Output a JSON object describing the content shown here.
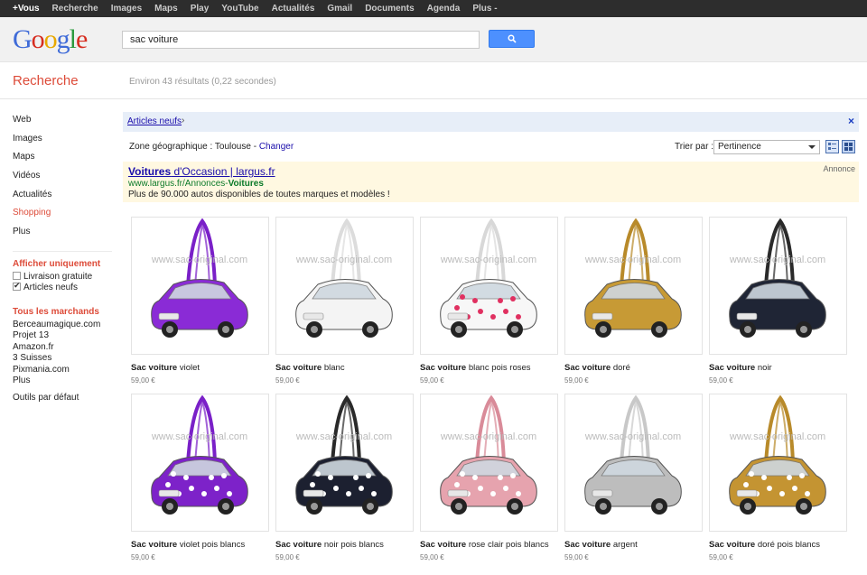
{
  "topnav": [
    "+Vous",
    "Recherche",
    "Images",
    "Maps",
    "Play",
    "YouTube",
    "Actualités",
    "Gmail",
    "Documents",
    "Agenda",
    "Plus -"
  ],
  "header": {
    "logo": "Google",
    "query": "sac voiture"
  },
  "results": {
    "section_title": "Recherche",
    "stats": "Environ 43 résultats (0,22 secondes)"
  },
  "leftnav": {
    "items": [
      "Web",
      "Images",
      "Maps",
      "Vidéos",
      "Actualités",
      "Shopping",
      "Plus"
    ],
    "active_index": 5,
    "filter_title": "Afficher uniquement",
    "filters": [
      {
        "label": "Livraison gratuite",
        "checked": false
      },
      {
        "label": "Articles neufs",
        "checked": true
      }
    ],
    "merchants_title": "Tous les marchands",
    "merchants": [
      "Berceaumagique.com",
      "Projet 13",
      "Amazon.fr",
      "3 Suisses",
      "Pixmania.com",
      "Plus"
    ],
    "tools": "Outils par défaut"
  },
  "filterbar": {
    "chip": "Articles neufs",
    "arrow": "›",
    "close": "×"
  },
  "zone": {
    "label": "Zone géographique : Toulouse - ",
    "change": "Changer"
  },
  "sort": {
    "label": "Trier par :",
    "value": "Pertinence"
  },
  "ad": {
    "title_bold": "Voitures",
    "title_rest": " d'Occasion | largus.fr",
    "url_start": "www.largus.fr/Annonces-",
    "url_bold": "Voitures",
    "description": "Plus de 90.000 autos disponibles de toutes marques et modèles !",
    "label": "Annonce"
  },
  "watermark": "www.sac-original.com",
  "colors": {
    "accent_red": "#dd4b39",
    "link": "#1a0dab",
    "url_green": "#0b7a29",
    "button_blue": "#4d90fe"
  },
  "products": [
    {
      "bold": "Sac voiture",
      "rest": " violet",
      "price": "59,00 €",
      "color": "#8a2bd6",
      "dots": "none",
      "strap": "#7a20c8"
    },
    {
      "bold": "Sac voiture",
      "rest": " blanc",
      "price": "59,00 €",
      "color": "#f4f4f4",
      "dots": "none",
      "strap": "#dcdcdc"
    },
    {
      "bold": "Sac voiture",
      "rest": " blanc pois roses",
      "price": "59,00 €",
      "color": "#f7f7f7",
      "dots": "#e03060",
      "strap": "#d8d8d8"
    },
    {
      "bold": "Sac voiture",
      "rest": " doré",
      "price": "59,00 €",
      "color": "#c79a35",
      "dots": "none",
      "strap": "#b88a2a"
    },
    {
      "bold": "Sac voiture",
      "rest": " noir",
      "price": "59,00 €",
      "color": "#1f2535",
      "dots": "none",
      "strap": "#2a2a2a"
    },
    {
      "bold": "Sac voiture",
      "rest": " violet pois blancs",
      "price": "59,00 €",
      "color": "#7d22c9",
      "dots": "#ffffff",
      "strap": "#7a20c8"
    },
    {
      "bold": "Sac voiture",
      "rest": " noir pois blancs",
      "price": "59,00 €",
      "color": "#1c2030",
      "dots": "#ffffff",
      "strap": "#2a2a2a"
    },
    {
      "bold": "Sac voiture",
      "rest": " rose clair pois blancs",
      "price": "59,00 €",
      "color": "#e6a3ae",
      "dots": "#ffffff",
      "strap": "#d98b99"
    },
    {
      "bold": "Sac voiture",
      "rest": " argent",
      "price": "59,00 €",
      "color": "#bdbdbd",
      "dots": "none",
      "strap": "#c8c8c8"
    },
    {
      "bold": "Sac voiture",
      "rest": " doré pois blancs",
      "price": "59,00 €",
      "color": "#c49432",
      "dots": "#ffffff",
      "strap": "#b88a2a"
    }
  ]
}
